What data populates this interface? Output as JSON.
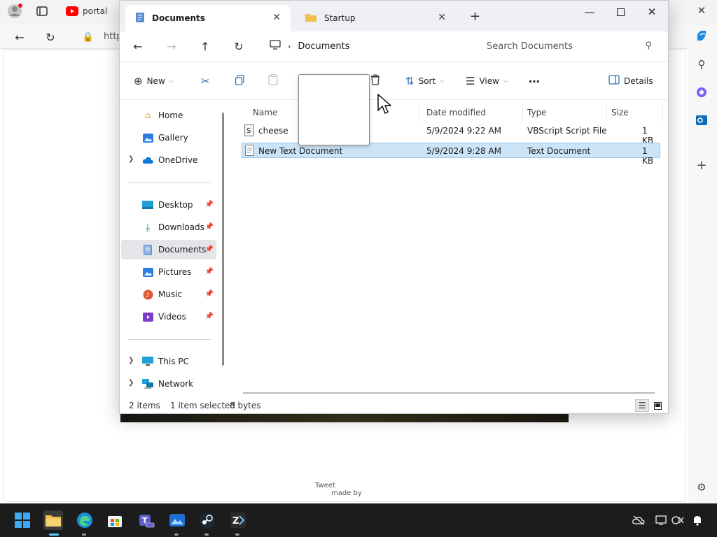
{
  "browser": {
    "tab_label": "portal",
    "address_partial": "http",
    "tweet_text": "Tweet",
    "madeby_text": "made by"
  },
  "window": {
    "tabs": [
      {
        "label": "Documents",
        "active": true
      },
      {
        "label": "Startup",
        "active": false
      }
    ]
  },
  "nav": {
    "location": "Documents",
    "search_placeholder": "Search Documents"
  },
  "toolbar": {
    "new_label": "New",
    "sort_label": "Sort",
    "view_label": "View",
    "details_label": "Details"
  },
  "sidebar": {
    "home": "Home",
    "gallery": "Gallery",
    "onedrive": "OneDrive",
    "desktop": "Desktop",
    "downloads": "Downloads",
    "documents": "Documents",
    "pictures": "Pictures",
    "music": "Music",
    "videos": "Videos",
    "thispc": "This PC",
    "network": "Network"
  },
  "columns": {
    "name": "Name",
    "date": "Date modified",
    "type": "Type",
    "size": "Size"
  },
  "files": [
    {
      "name": "cheese",
      "date": "5/9/2024 9:22 AM",
      "type": "VBScript Script File",
      "size": "1 KB",
      "selected": false
    },
    {
      "name": "New Text Document",
      "date": "5/9/2024 9:28 AM",
      "type": "Text Document",
      "size": "1 KB",
      "selected": true
    }
  ],
  "status": {
    "items": "2 items",
    "selected": "1 item selected",
    "bytes": "8 bytes"
  },
  "colors": {
    "accent": "#2d6fb3",
    "selection": "#cce4f7",
    "taskbar": "#1c1c1c"
  }
}
